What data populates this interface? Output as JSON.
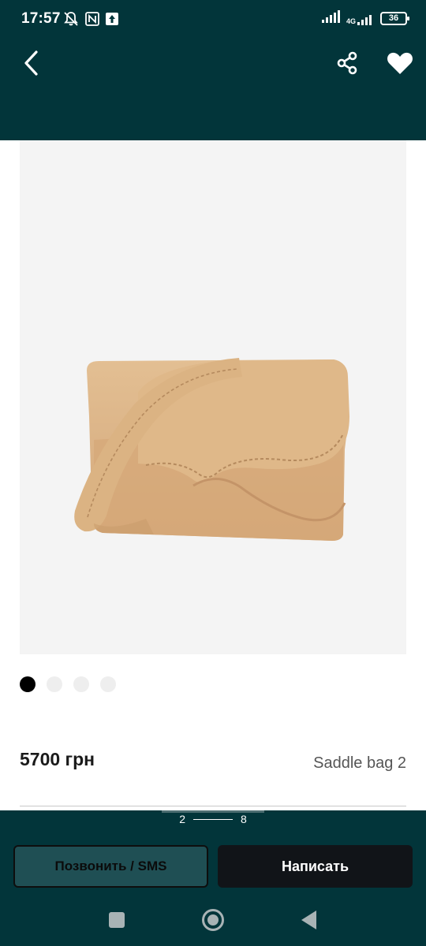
{
  "status_bar": {
    "time": "17:57",
    "network_type": "4G",
    "battery_level": "36",
    "icons": [
      "mute-bell-icon",
      "nfc-icon",
      "upload-icon",
      "signal-icon",
      "signal-4g-icon",
      "battery-icon"
    ]
  },
  "app_bar": {
    "back_icon": "chevron-left-icon",
    "share_icon": "share-icon",
    "favorite_icon": "heart-icon"
  },
  "gallery": {
    "image_alt": "Saddle bag",
    "total_dots": 4,
    "active_index": 0
  },
  "product": {
    "price": "5700 грн",
    "title": "Saddle bag 2"
  },
  "pager": {
    "current": "2",
    "total": "8"
  },
  "actions": {
    "call_label": "Позвонить / SMS",
    "write_label": "Написать"
  },
  "nav_bar": {
    "icons": [
      "recents-icon",
      "home-icon",
      "back-triangle-icon"
    ]
  },
  "colors": {
    "header_bg": "#02353a",
    "write_button_bg": "#111418",
    "call_button_bg": "#1f4f54",
    "bag_color": "#dcb387"
  }
}
